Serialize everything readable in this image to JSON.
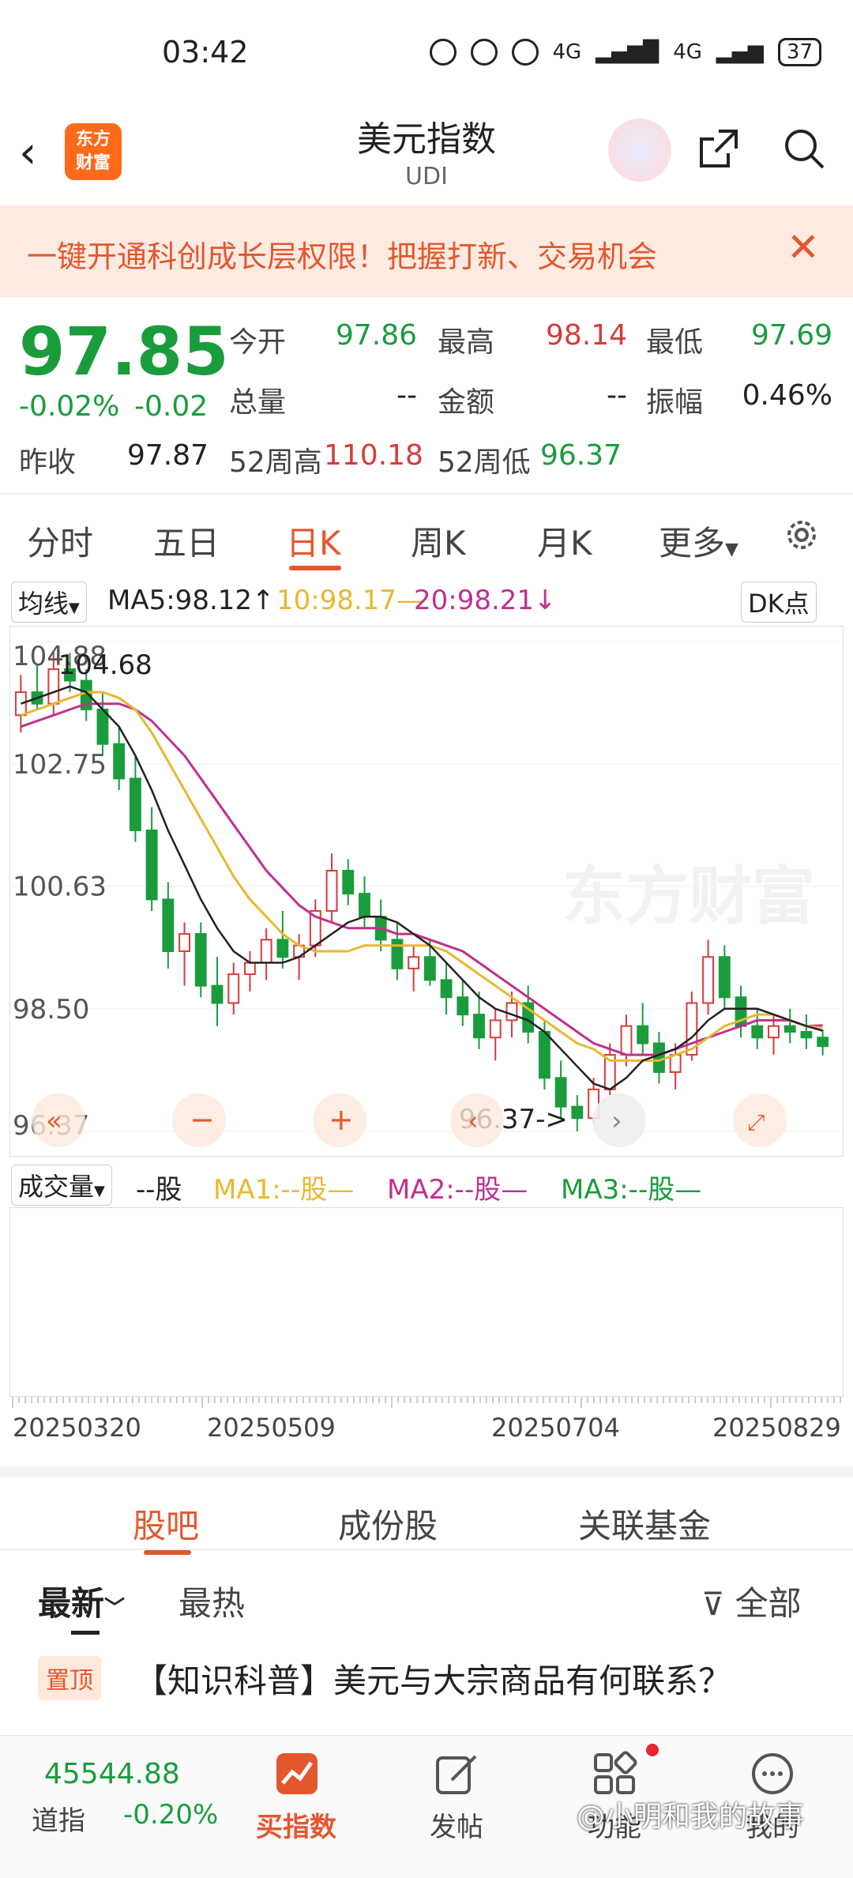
{
  "status_bar": {
    "time": "03:42",
    "net1": "4G",
    "net2": "4G",
    "battery": "37"
  },
  "header": {
    "title": "美元指数",
    "subtitle": "UDI",
    "logo_line1": "东方",
    "logo_line2": "财富"
  },
  "banner": {
    "text": "一键开通科创成长层权限！把握打新、交易机会"
  },
  "quote": {
    "price": "97.85",
    "change_pct": "-0.02%",
    "change": "-0.02",
    "open_label": "今开",
    "open": "97.86",
    "high_label": "最高",
    "high": "98.14",
    "low_label": "最低",
    "low": "97.69",
    "volume_label": "总量",
    "volume": "--",
    "amount_label": "金额",
    "amount": "--",
    "amplitude_label": "振幅",
    "amplitude": "0.46%",
    "prev_label": "昨收",
    "prev": "97.87",
    "wk52_high_label": "52周高",
    "wk52_high": "110.18",
    "wk52_low_label": "52周低",
    "wk52_low": "96.37"
  },
  "period_tabs": [
    "分时",
    "五日",
    "日K",
    "周K",
    "月K",
    "更多"
  ],
  "ma_bar": {
    "selector": "均线",
    "ma5": "MA5:98.12↑",
    "ma10": "10:98.17—",
    "ma20": "20:98.21↓",
    "dk": "DK点"
  },
  "chart_data": {
    "type": "candlestick",
    "y_ticks": [
      "104.88",
      "102.75",
      "100.63",
      "98.50",
      "96.37"
    ],
    "ylim": [
      96.37,
      104.88
    ],
    "max_label": "104.68",
    "min_label": "96.37->",
    "x_ticks": [
      "20250320",
      "20250509",
      "20250704",
      "20250829"
    ],
    "watermark": "东方财富",
    "candles": [
      [
        103.6,
        104.3,
        103.3,
        104.0
      ],
      [
        104.0,
        104.5,
        103.7,
        103.8
      ],
      [
        103.8,
        104.7,
        103.6,
        104.4
      ],
      [
        104.4,
        104.68,
        104.0,
        104.2
      ],
      [
        104.2,
        104.4,
        103.5,
        103.7
      ],
      [
        103.7,
        104.0,
        102.9,
        103.1
      ],
      [
        103.1,
        103.4,
        102.3,
        102.5
      ],
      [
        102.5,
        102.9,
        101.4,
        101.6
      ],
      [
        101.6,
        102.0,
        100.2,
        100.4
      ],
      [
        100.4,
        100.7,
        99.2,
        99.5
      ],
      [
        99.5,
        100.0,
        98.9,
        99.8
      ],
      [
        99.8,
        100.0,
        98.7,
        98.9
      ],
      [
        98.9,
        99.4,
        98.2,
        98.6
      ],
      [
        98.6,
        99.3,
        98.4,
        99.1
      ],
      [
        99.1,
        99.5,
        98.8,
        99.3
      ],
      [
        99.3,
        99.9,
        99.0,
        99.7
      ],
      [
        99.7,
        100.2,
        99.2,
        99.4
      ],
      [
        99.4,
        99.8,
        99.0,
        99.6
      ],
      [
        99.6,
        100.4,
        99.4,
        100.2
      ],
      [
        100.2,
        101.2,
        100.0,
        100.9
      ],
      [
        100.9,
        101.1,
        100.3,
        100.5
      ],
      [
        100.5,
        100.8,
        99.9,
        100.1
      ],
      [
        100.1,
        100.4,
        99.5,
        99.7
      ],
      [
        99.7,
        100.0,
        99.0,
        99.2
      ],
      [
        99.2,
        99.6,
        98.8,
        99.4
      ],
      [
        99.4,
        99.7,
        98.9,
        99.0
      ],
      [
        99.0,
        99.3,
        98.4,
        98.7
      ],
      [
        98.7,
        99.0,
        98.2,
        98.4
      ],
      [
        98.4,
        98.8,
        97.8,
        98.0
      ],
      [
        98.0,
        98.5,
        97.6,
        98.3
      ],
      [
        98.3,
        98.8,
        98.0,
        98.6
      ],
      [
        98.6,
        98.9,
        97.9,
        98.1
      ],
      [
        98.1,
        98.3,
        97.1,
        97.3
      ],
      [
        97.3,
        97.6,
        96.6,
        96.8
      ],
      [
        96.8,
        97.0,
        96.37,
        96.6
      ],
      [
        96.6,
        97.3,
        96.5,
        97.1
      ],
      [
        97.1,
        97.9,
        97.0,
        97.7
      ],
      [
        97.7,
        98.4,
        97.5,
        98.2
      ],
      [
        98.2,
        98.6,
        97.7,
        97.9
      ],
      [
        97.9,
        98.1,
        97.2,
        97.4
      ],
      [
        97.4,
        97.9,
        97.1,
        97.7
      ],
      [
        97.7,
        98.8,
        97.6,
        98.6
      ],
      [
        98.6,
        99.7,
        98.4,
        99.4
      ],
      [
        99.4,
        99.6,
        98.5,
        98.7
      ],
      [
        98.7,
        98.9,
        98.0,
        98.2
      ],
      [
        98.2,
        98.5,
        97.8,
        98.0
      ],
      [
        98.0,
        98.4,
        97.7,
        98.2
      ],
      [
        98.2,
        98.5,
        97.9,
        98.1
      ],
      [
        98.1,
        98.4,
        97.8,
        98.0
      ],
      [
        98.0,
        98.14,
        97.69,
        97.85
      ]
    ],
    "ma5": [
      103.8,
      103.9,
      104.0,
      104.1,
      104.0,
      103.7,
      103.4,
      102.9,
      102.3,
      101.6,
      101.0,
      100.4,
      99.9,
      99.5,
      99.3,
      99.3,
      99.3,
      99.4,
      99.6,
      99.8,
      100.0,
      100.1,
      100.1,
      100.0,
      99.8,
      99.6,
      99.3,
      99.0,
      98.7,
      98.5,
      98.4,
      98.3,
      98.1,
      97.8,
      97.5,
      97.2,
      97.1,
      97.3,
      97.6,
      97.7,
      97.8,
      98.0,
      98.3,
      98.5,
      98.5,
      98.5,
      98.4,
      98.3,
      98.2,
      98.12
    ],
    "ma10": [
      103.6,
      103.7,
      103.8,
      103.9,
      104.0,
      104.0,
      103.9,
      103.7,
      103.3,
      102.8,
      102.3,
      101.8,
      101.3,
      100.8,
      100.4,
      100.1,
      99.8,
      99.6,
      99.5,
      99.5,
      99.5,
      99.6,
      99.6,
      99.6,
      99.6,
      99.6,
      99.5,
      99.3,
      99.1,
      98.9,
      98.7,
      98.5,
      98.3,
      98.1,
      97.9,
      97.8,
      97.6,
      97.6,
      97.6,
      97.6,
      97.7,
      97.8,
      98.0,
      98.2,
      98.3,
      98.4,
      98.4,
      98.3,
      98.2,
      98.17
    ],
    "ma20": [
      103.4,
      103.5,
      103.6,
      103.7,
      103.8,
      103.8,
      103.8,
      103.7,
      103.5,
      103.2,
      102.9,
      102.5,
      102.1,
      101.7,
      101.3,
      100.9,
      100.6,
      100.3,
      100.1,
      100.0,
      99.9,
      99.9,
      99.9,
      99.8,
      99.8,
      99.7,
      99.6,
      99.5,
      99.3,
      99.1,
      98.9,
      98.7,
      98.5,
      98.3,
      98.1,
      97.9,
      97.8,
      97.7,
      97.7,
      97.7,
      97.8,
      97.9,
      98.0,
      98.1,
      98.2,
      98.3,
      98.3,
      98.3,
      98.2,
      98.21
    ]
  },
  "volume": {
    "selector": "成交量",
    "unit": "--股",
    "ma1": "MA1:--股—",
    "ma2": "MA2:--股—",
    "ma3": "MA3:--股—"
  },
  "section_tabs": [
    "股吧",
    "成份股",
    "关联基金"
  ],
  "feed": {
    "sort_new": "最新",
    "sort_hot": "最热",
    "filter": "全部",
    "pinned_tag": "置顶",
    "post_title": "【知识科普】美元与大宗商品有何联系？"
  },
  "bottom_bar": {
    "index_value": "45544.88",
    "index_name": "道指",
    "index_change": "-0.20%",
    "buy": "买指数",
    "post": "发帖",
    "func": "功能",
    "mine": "我的"
  },
  "watermark_text": "@小明和我的故事",
  "colors": {
    "accent": "#e4572e",
    "up": "#d63b3b",
    "down": "#1a9c3c",
    "ma5": "#222222",
    "ma10": "#e8b830",
    "ma20": "#c0308e"
  }
}
